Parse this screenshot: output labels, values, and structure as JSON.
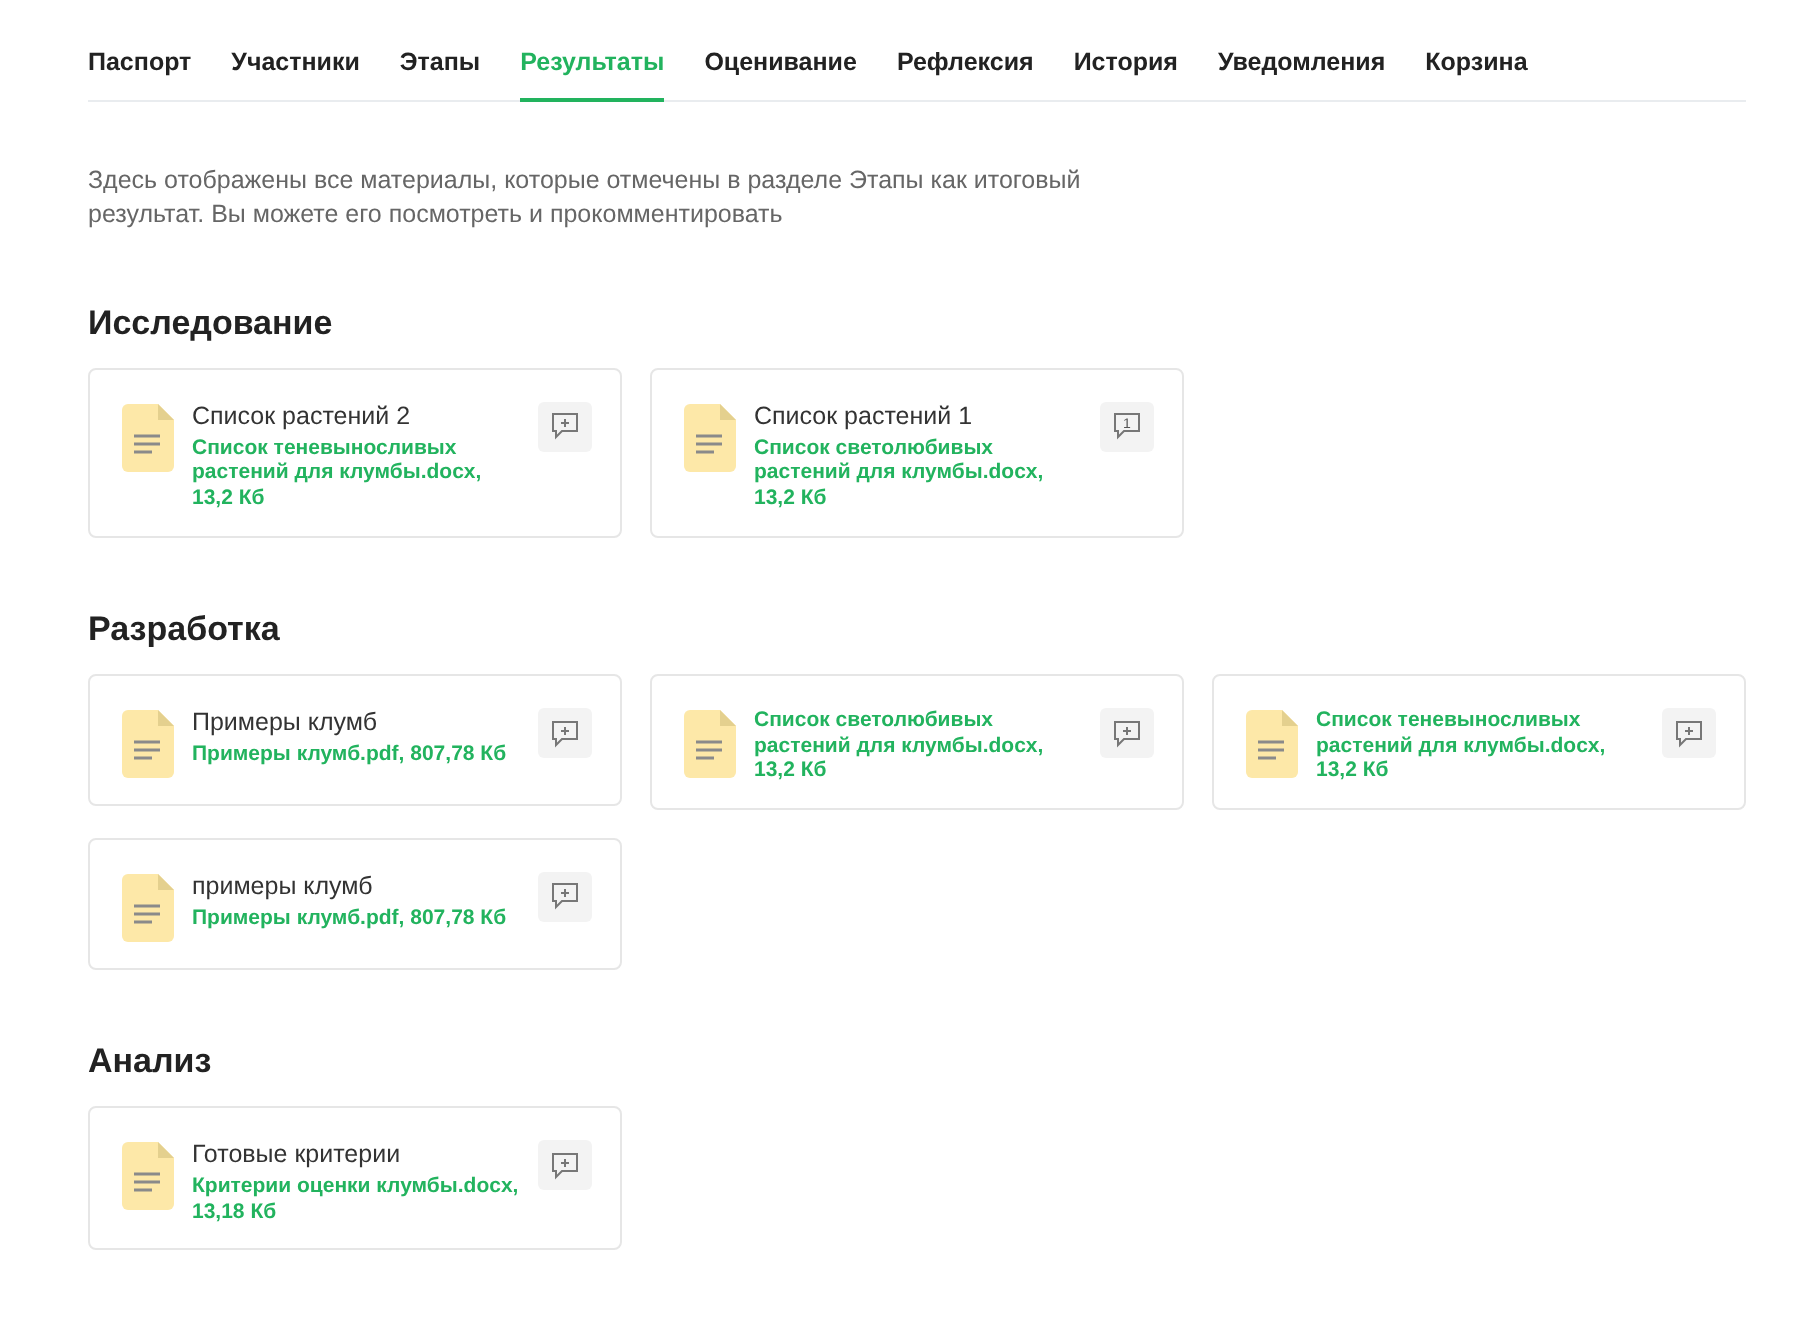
{
  "tabs": [
    {
      "label": "Паспорт",
      "selected": false
    },
    {
      "label": "Участники",
      "selected": false
    },
    {
      "label": "Этапы",
      "selected": false
    },
    {
      "label": "Результаты",
      "selected": true
    },
    {
      "label": "Оценивание",
      "selected": false
    },
    {
      "label": "Рефлексия",
      "selected": false
    },
    {
      "label": "История",
      "selected": false
    },
    {
      "label": "Уведомления",
      "selected": false
    },
    {
      "label": "Корзина",
      "selected": false
    }
  ],
  "description": "Здесь отображены все материалы, которые отмечены в разделе Этапы как итоговый результат. Вы можете его посмотреть и прокомментировать",
  "sections": [
    {
      "title": "Исследование",
      "items": [
        {
          "title": "Список растений 2",
          "file": "Список теневыносливых растений для клумбы.docx, 13,2 Кб"
        },
        {
          "title": "Список растений 1",
          "file": "Список светолюбивых растений для клумбы.docx, 13,2 Кб",
          "comment_count": "1"
        }
      ]
    },
    {
      "title": "Разработка",
      "items": [
        {
          "title": "Примеры клумб",
          "file": "Примеры клумб.pdf, 807,78 Кб"
        },
        {
          "file": "Список светолюбивых растений для клумбы.docx, 13,2 Кб"
        },
        {
          "file": "Список теневыносливых растений для клумбы.docx, 13,2 Кб"
        },
        {
          "title": "примеры клумб",
          "file": "Примеры клумб.pdf, 807,78 Кб"
        }
      ]
    },
    {
      "title": "Анализ",
      "items": [
        {
          "title": "Готовые критерии",
          "file": "Критерии оценки клумбы.docx, 13,18 Кб"
        }
      ]
    }
  ]
}
